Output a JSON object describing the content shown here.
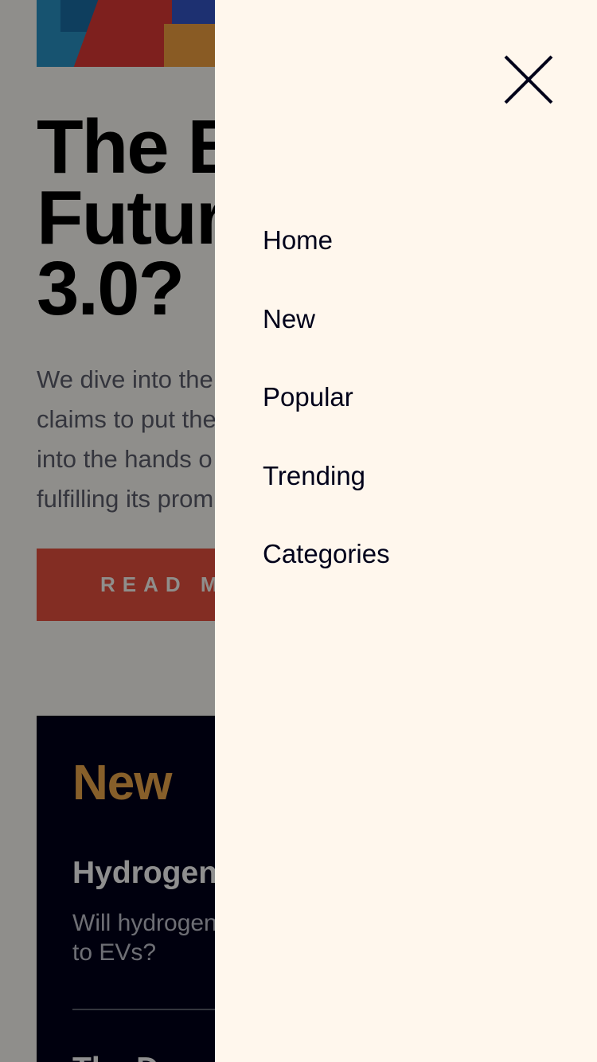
{
  "hero": {
    "title": "The B\nFutur\n3.0?",
    "description": "We dive into the\nclaims to put the\ninto the hands o\nfulfilling its prom",
    "read_more_label": "READ M"
  },
  "new_section": {
    "heading": "New",
    "items": [
      {
        "title": "Hydrogen",
        "description": "Will hydrogen\nto EVs?"
      },
      {
        "title": "The Dow"
      }
    ]
  },
  "drawer": {
    "close_icon": "close-icon",
    "nav_items": [
      {
        "label": "Home"
      },
      {
        "label": "New"
      },
      {
        "label": "Popular"
      },
      {
        "label": "Trending"
      },
      {
        "label": "Categories"
      }
    ]
  },
  "colors": {
    "page_background": "#fffdf8",
    "drawer_background": "#fff7ed",
    "text_dark": "#00011a",
    "text_muted": "#5d5f6d",
    "accent_red": "#e9503f",
    "accent_orange": "#f0a94c",
    "overlay": "rgba(0,0,0,0.44)"
  }
}
